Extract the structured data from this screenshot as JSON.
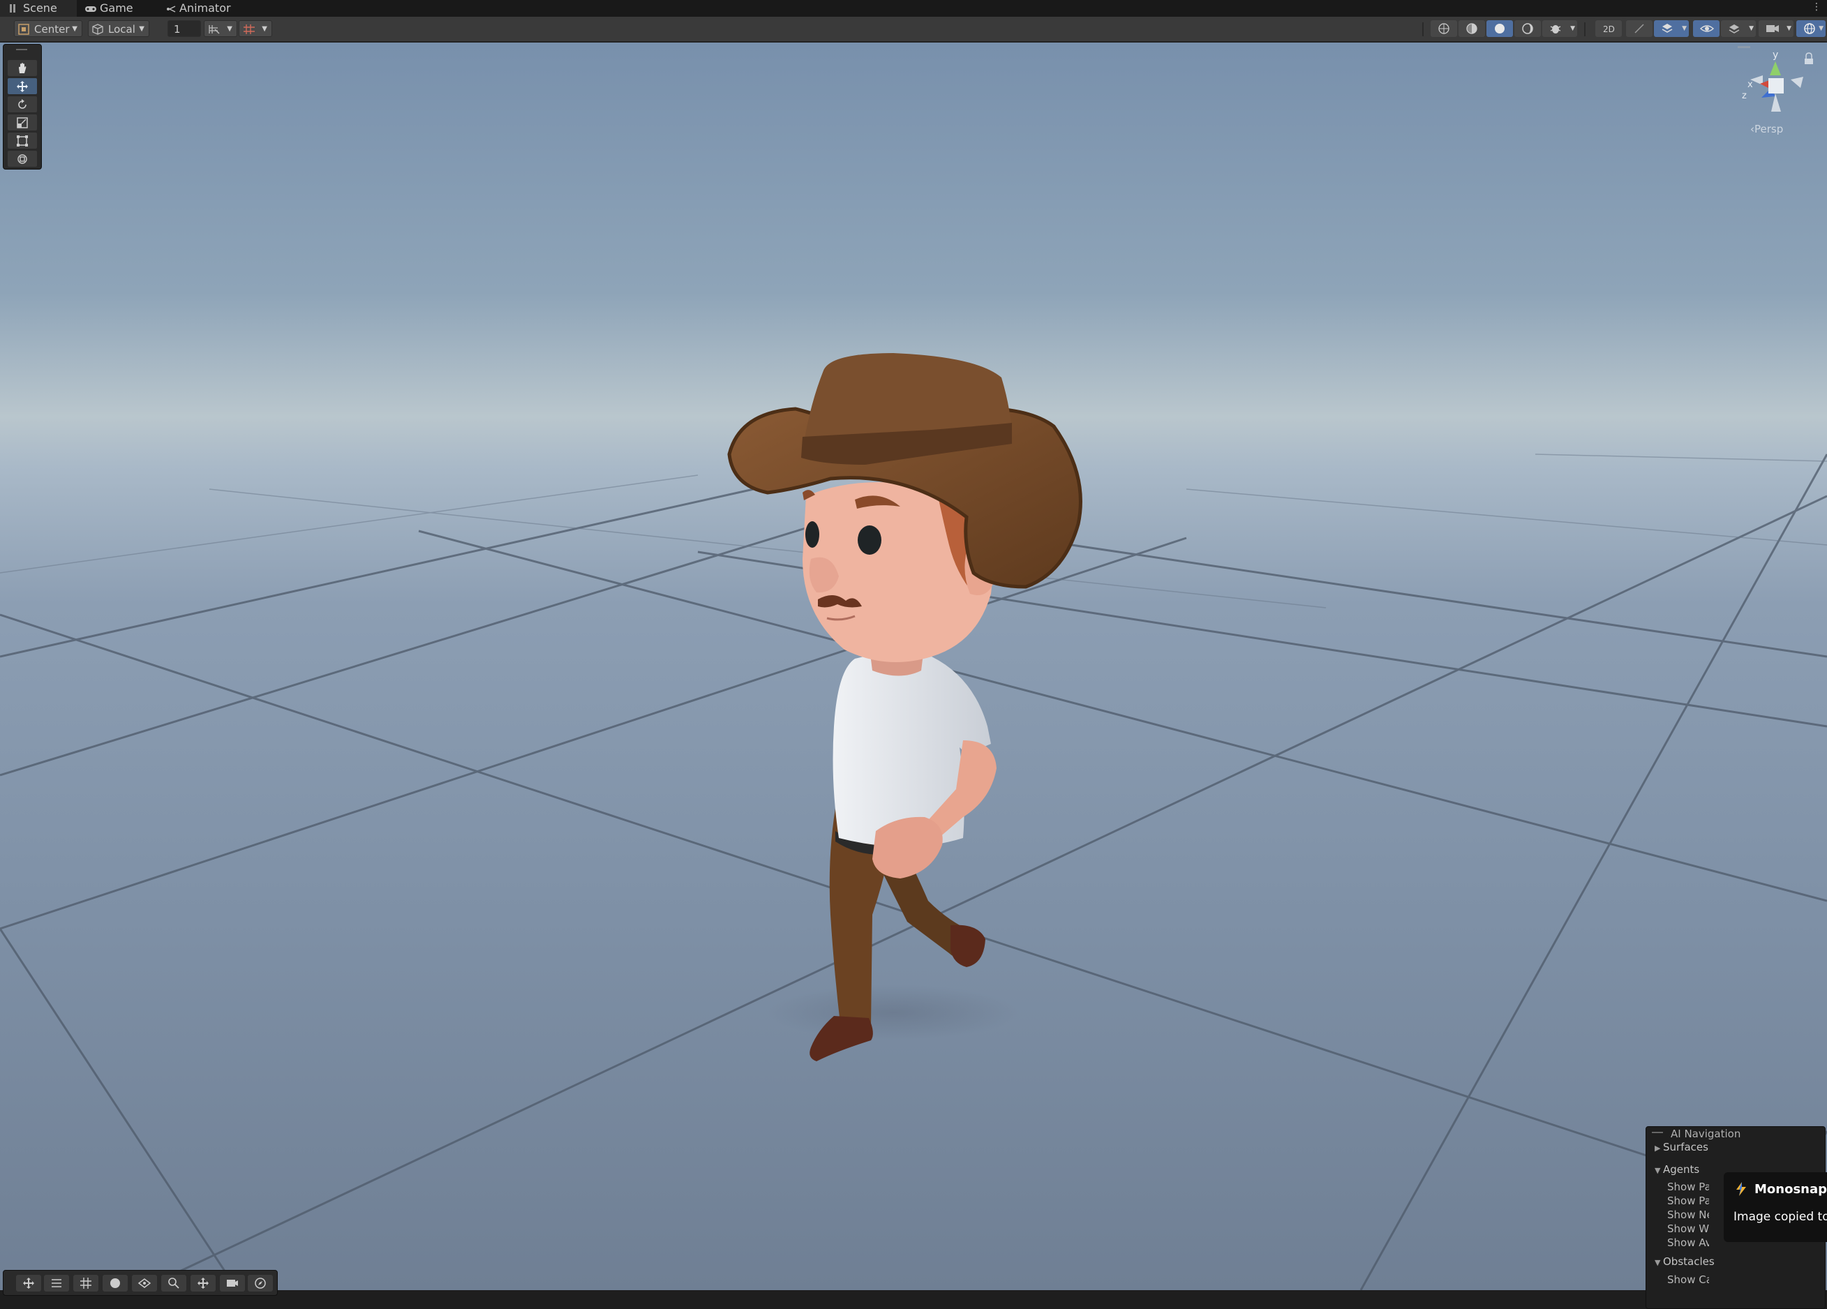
{
  "tabs": {
    "scene": "Scene",
    "game": "Game",
    "animator": "Animator"
  },
  "toolbar": {
    "pivot_mode": "Center",
    "pivot_rotation": "Local",
    "grid_size": "1"
  },
  "scene_view": {
    "projection_label": "‹Persp",
    "gizmo_axes": [
      "y",
      "x",
      "z"
    ]
  },
  "ai_navigation": {
    "title": "AI Navigation",
    "surfaces": "Surfaces",
    "agents": "Agents",
    "agent_options": [
      "Show Pat",
      "Show Pat",
      "Show Ne",
      "Show Wa",
      "Show Avo"
    ],
    "obstacles": "Obstacles",
    "obstacle_options": [
      "Show Ca"
    ]
  },
  "toast": {
    "app": "Monosnap",
    "message": "Image copied to"
  },
  "icons": {
    "tools": [
      "hand-icon",
      "move-icon",
      "rotate-icon",
      "scale-icon",
      "rect-icon",
      "transform-icon"
    ],
    "bottom_tools": [
      "move-icon",
      "snap-icon",
      "grid-icon",
      "sphere-icon",
      "visibility-icon",
      "search-icon",
      "move-icon",
      "camera-icon",
      "compass-icon"
    ]
  },
  "colors": {
    "accent": "#4f6fa0",
    "hat": "#7a4f2e",
    "shirt": "#e3e6ea",
    "pants": "#6b4222",
    "skin": "#e8a58f"
  }
}
